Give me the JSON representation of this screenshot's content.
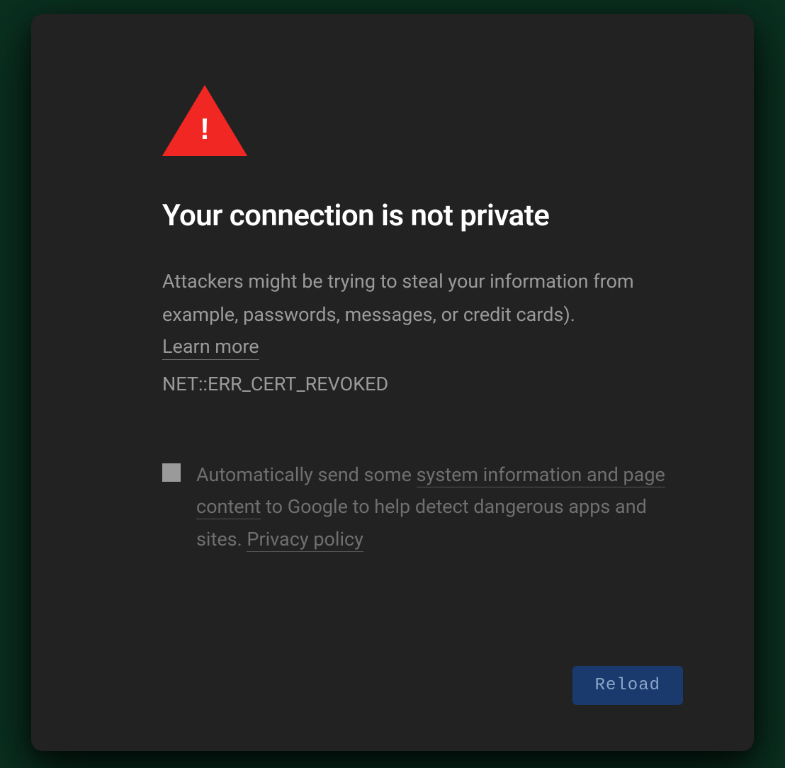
{
  "heading": "Your connection is not private",
  "description": "Attackers might be trying to steal your information from example, passwords, messages, or credit cards).",
  "learn_more": "Learn more",
  "error_code": "NET::ERR_CERT_REVOKED",
  "checkbox": {
    "text_prefix": "Automatically send some ",
    "link1": "system information and page content",
    "text_middle": " to Google to help detect dangerous apps and sites. ",
    "link2": "Privacy policy"
  },
  "reload_button": "Reload"
}
